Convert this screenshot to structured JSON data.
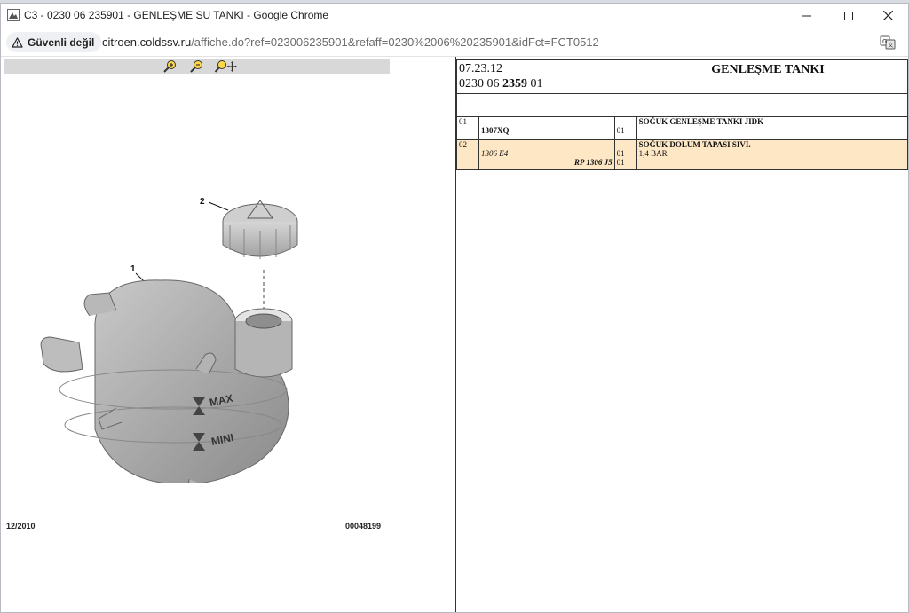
{
  "window": {
    "title": "C3 - 0230 06 235901 - GENLEŞME SU TANKI - Google Chrome"
  },
  "address_bar": {
    "security_label": "Güvenli değil",
    "url_host": "citroen.coldssv.ru",
    "url_rest": "/affiche.do?ref=023006235901&refaff=0230%2006%20235901&idFct=FCT0512"
  },
  "colors": {
    "highlight_row": "#fde7c4",
    "toolbar_strip": "#d8d8d8",
    "zoom_icon": "#e0a800"
  },
  "diagram": {
    "callout_1": "1",
    "callout_2": "2",
    "tank_text_max": "MAX",
    "tank_text_mini": "MINI",
    "date": "12/2010",
    "figure_number": "00048199"
  },
  "header": {
    "code": "07.23.12",
    "ref_prefix": "0230 06 ",
    "ref_bold": "2359",
    "ref_suffix": " 01",
    "title": "GENLEŞME TANKI"
  },
  "parts": [
    {
      "index": "01",
      "ref": "1307XQ",
      "rp": "",
      "qty": [
        "01"
      ],
      "desc_bold": "SOĞUK GENLEŞME TANKI JIDK",
      "desc": ""
    },
    {
      "index": "02",
      "ref": "1306 E4",
      "rp": "RP 1306 J5",
      "qty": [
        "01",
        "01"
      ],
      "desc_bold": "SOĞUK DOLUM TAPASI SIVI.",
      "desc": "1,4 BAR"
    }
  ]
}
